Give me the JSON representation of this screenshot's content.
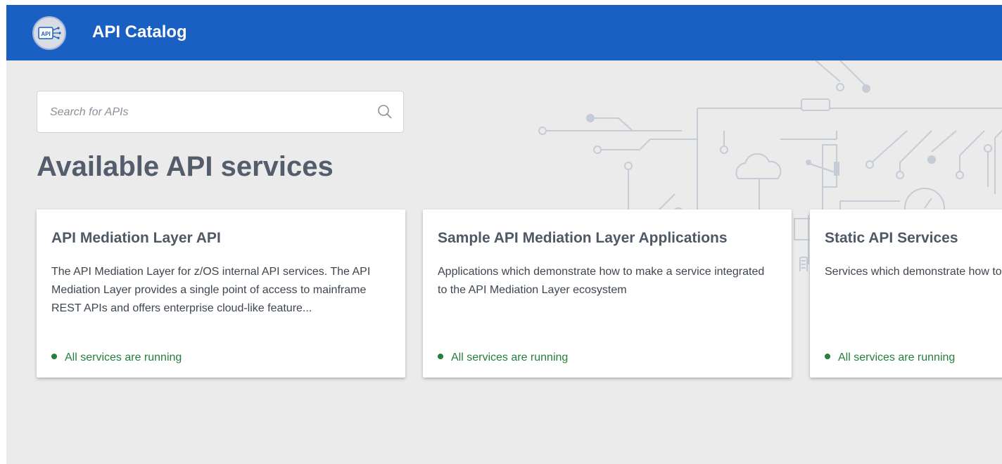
{
  "header": {
    "title": "API Catalog",
    "logo_text": "API",
    "logo_icon": "api-logo-icon"
  },
  "search": {
    "placeholder": "Search for APIs",
    "value": "",
    "icon": "search-icon"
  },
  "page": {
    "title": "Available API services"
  },
  "cards": [
    {
      "title": "API Mediation Layer API",
      "description": "The API Mediation Layer for z/OS internal API services. The API Mediation Layer provides a single point of access to mainframe REST APIs and offers enterprise cloud-like feature...",
      "status": "All services are running"
    },
    {
      "title": "Sample API Mediation Layer Applications",
      "description": "Applications which demonstrate how to make a service integrated to the API Mediation Layer ecosystem",
      "status": "All services are running"
    },
    {
      "title": "Static API Services",
      "description": "Services which demonstrate how to make an API service discoverable in the APIML ecosystem using static definitions",
      "status": "All services are running"
    }
  ],
  "colors": {
    "header": "#1a5fc2",
    "background": "#ebebeb",
    "status_ok": "#24803a",
    "title_text": "#545d6b"
  }
}
